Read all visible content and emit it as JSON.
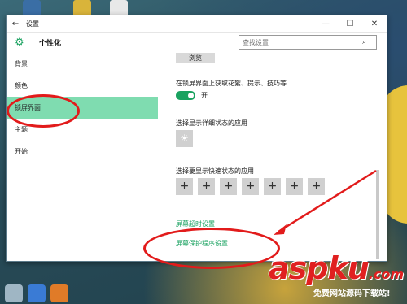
{
  "window": {
    "title": "设置",
    "back_glyph": "←",
    "minimize_glyph": "—",
    "maximize_glyph": "☐",
    "close_glyph": "✕"
  },
  "header": {
    "icon": "gear-icon",
    "title": "个性化",
    "search_placeholder": "查找设置"
  },
  "sidebar": {
    "items": [
      {
        "label": "背景",
        "active": false
      },
      {
        "label": "颜色",
        "active": false
      },
      {
        "label": "锁屏界面",
        "active": true
      },
      {
        "label": "主题",
        "active": false
      },
      {
        "label": "开始",
        "active": false
      }
    ]
  },
  "content": {
    "browse_label": "浏览",
    "tips_label": "在锁屏界面上获取花絮、提示、技巧等",
    "toggle_state": "开",
    "toggle_on": true,
    "detail_label": "选择显示详细状态的应用",
    "detail_icon": "sun-icon",
    "quick_label": "选择要显示快速状态的应用",
    "quick_slots": [
      "+",
      "+",
      "+",
      "+",
      "+",
      "+",
      "+"
    ],
    "timeout_link": "屏幕超时设置",
    "saver_link": "屏幕保护程序设置"
  },
  "watermark": {
    "brand": "aspku",
    "tld": ".com",
    "sub": "免费网站源码下载站!"
  },
  "colors": {
    "accent": "#1aa260",
    "sidebar_active": "#7fdcb0",
    "annotation": "#e21b1b"
  }
}
